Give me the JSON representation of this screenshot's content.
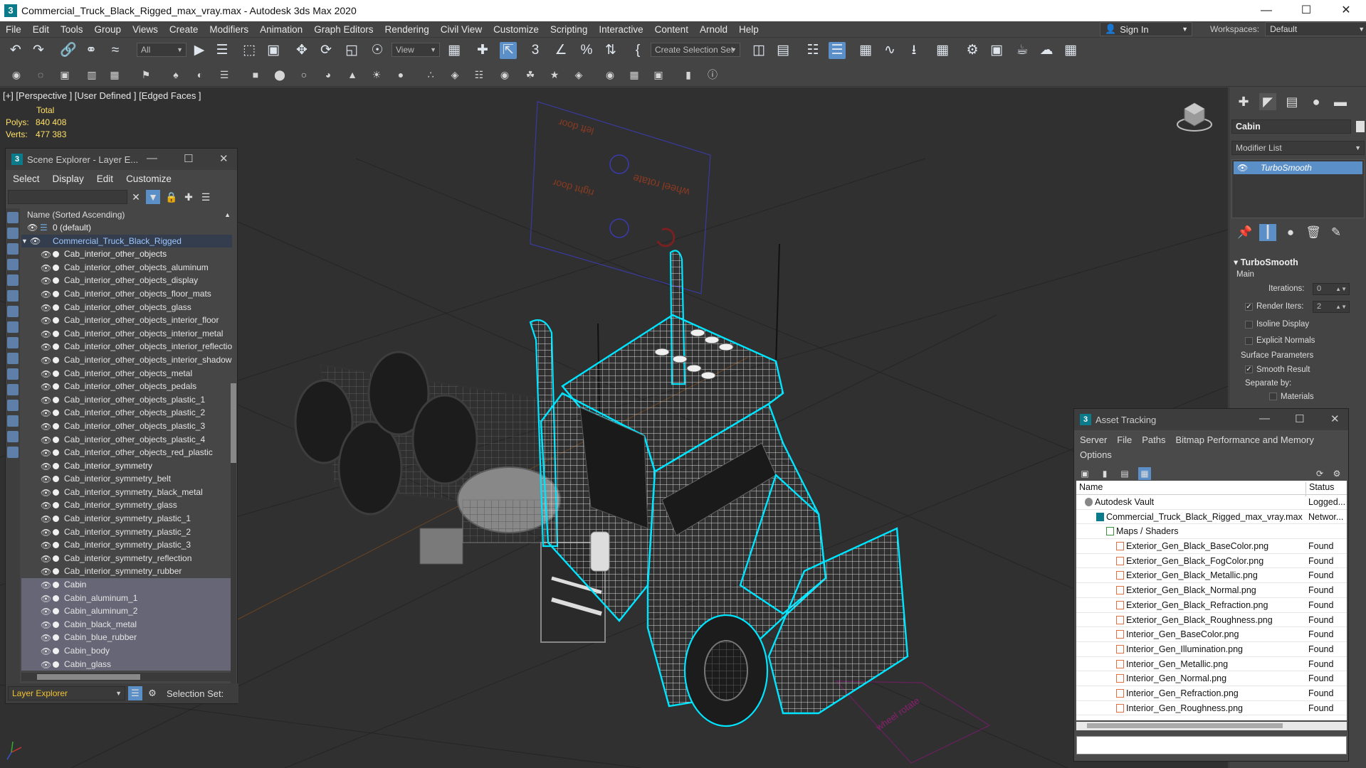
{
  "window": {
    "title": "Commercial_Truck_Black_Rigged_max_vray.max - Autodesk 3ds Max 2020"
  },
  "menubar": {
    "items": [
      "File",
      "Edit",
      "Tools",
      "Group",
      "Views",
      "Create",
      "Modifiers",
      "Animation",
      "Graph Editors",
      "Rendering",
      "Civil View",
      "Customize",
      "Scripting",
      "Interactive",
      "Content",
      "Arnold",
      "Help"
    ],
    "sign_in": "Sign In",
    "workspaces_label": "Workspaces:",
    "workspaces_value": "Default"
  },
  "toolbar": {
    "filter_dropdown": "All",
    "refcoord_dropdown": "View",
    "selection_set_dropdown": "Create Selection Set"
  },
  "viewport": {
    "label": "[+] [Perspective ] [User Defined ] [Edged Faces ]",
    "stats": {
      "total_label": "Total",
      "polys_label": "Polys:",
      "polys_value": "840 408",
      "verts_label": "Verts:",
      "verts_value": "477 383"
    },
    "rig_labels": {
      "left_door": "left door",
      "right_door": "right door",
      "wheel_rotate": "wheel rotate",
      "bottom_label": "wheel rotate"
    }
  },
  "scene_explorer": {
    "title": "Scene Explorer - Layer E...",
    "menu": [
      "Select",
      "Display",
      "Edit",
      "Customize"
    ],
    "column_header": "Name (Sorted Ascending)",
    "layer_default": "0 (default)",
    "layer_main": "Commercial_Truck_Black_Rigged",
    "items": [
      "Cab_interior_other_objects",
      "Cab_interior_other_objects_aluminum",
      "Cab_interior_other_objects_display",
      "Cab_interior_other_objects_floor_mats",
      "Cab_interior_other_objects_glass",
      "Cab_interior_other_objects_interior_floor",
      "Cab_interior_other_objects_interior_metal",
      "Cab_interior_other_objects_interior_reflection",
      "Cab_interior_other_objects_interior_shadow",
      "Cab_interior_other_objects_metal",
      "Cab_interior_other_objects_pedals",
      "Cab_interior_other_objects_plastic_1",
      "Cab_interior_other_objects_plastic_2",
      "Cab_interior_other_objects_plastic_3",
      "Cab_interior_other_objects_plastic_4",
      "Cab_interior_other_objects_red_plastic",
      "Cab_interior_symmetry",
      "Cab_interior_symmetry_belt",
      "Cab_interior_symmetry_black_metal",
      "Cab_interior_symmetry_glass",
      "Cab_interior_symmetry_plastic_1",
      "Cab_interior_symmetry_plastic_2",
      "Cab_interior_symmetry_plastic_3",
      "Cab_interior_symmetry_reflection",
      "Cab_interior_symmetry_rubber",
      "Cabin",
      "Cabin_aluminum_1",
      "Cabin_aluminum_2",
      "Cabin_black_metal",
      "Cabin_blue_rubber",
      "Cabin_body",
      "Cabin_glass"
    ],
    "footer_dropdown": "Layer Explorer",
    "footer_selection_set": "Selection Set:"
  },
  "command_panel": {
    "object_name": "Cabin",
    "modifier_list": "Modifier List",
    "stack_item": "TurboSmooth",
    "rollout_title": "TurboSmooth",
    "main_label": "Main",
    "iterations_label": "Iterations:",
    "iterations_value": "0",
    "render_iters_label": "Render Iters:",
    "render_iters_value": "2",
    "isoline_display": "Isoline Display",
    "explicit_normals": "Explicit Normals",
    "surface_parameters": "Surface Parameters",
    "smooth_result": "Smooth Result",
    "separate_by": "Separate by:",
    "materials": "Materials"
  },
  "asset_tracking": {
    "title": "Asset Tracking",
    "menu": [
      "Server",
      "File",
      "Paths",
      "Bitmap Performance and Memory",
      "Options"
    ],
    "col_name": "Name",
    "col_status": "Status",
    "rows": [
      {
        "name": "Autodesk Vault",
        "status": "Logged...",
        "level": 0,
        "icon": "vault"
      },
      {
        "name": "Commercial_Truck_Black_Rigged_max_vray.max",
        "status": "Networ...",
        "level": 1,
        "icon": "max"
      },
      {
        "name": "Maps / Shaders",
        "status": "",
        "level": 2,
        "icon": "folder"
      },
      {
        "name": "Exterior_Gen_Black_BaseColor.png",
        "status": "Found",
        "level": 3,
        "icon": "file"
      },
      {
        "name": "Exterior_Gen_Black_FogColor.png",
        "status": "Found",
        "level": 3,
        "icon": "file"
      },
      {
        "name": "Exterior_Gen_Black_Metallic.png",
        "status": "Found",
        "level": 3,
        "icon": "file"
      },
      {
        "name": "Exterior_Gen_Black_Normal.png",
        "status": "Found",
        "level": 3,
        "icon": "file"
      },
      {
        "name": "Exterior_Gen_Black_Refraction.png",
        "status": "Found",
        "level": 3,
        "icon": "file"
      },
      {
        "name": "Exterior_Gen_Black_Roughness.png",
        "status": "Found",
        "level": 3,
        "icon": "file"
      },
      {
        "name": "Interior_Gen_BaseColor.png",
        "status": "Found",
        "level": 3,
        "icon": "file"
      },
      {
        "name": "Interior_Gen_Illumination.png",
        "status": "Found",
        "level": 3,
        "icon": "file"
      },
      {
        "name": "Interior_Gen_Metallic.png",
        "status": "Found",
        "level": 3,
        "icon": "file"
      },
      {
        "name": "Interior_Gen_Normal.png",
        "status": "Found",
        "level": 3,
        "icon": "file"
      },
      {
        "name": "Interior_Gen_Refraction.png",
        "status": "Found",
        "level": 3,
        "icon": "file"
      },
      {
        "name": "Interior_Gen_Roughness.png",
        "status": "Found",
        "level": 3,
        "icon": "file"
      }
    ]
  }
}
